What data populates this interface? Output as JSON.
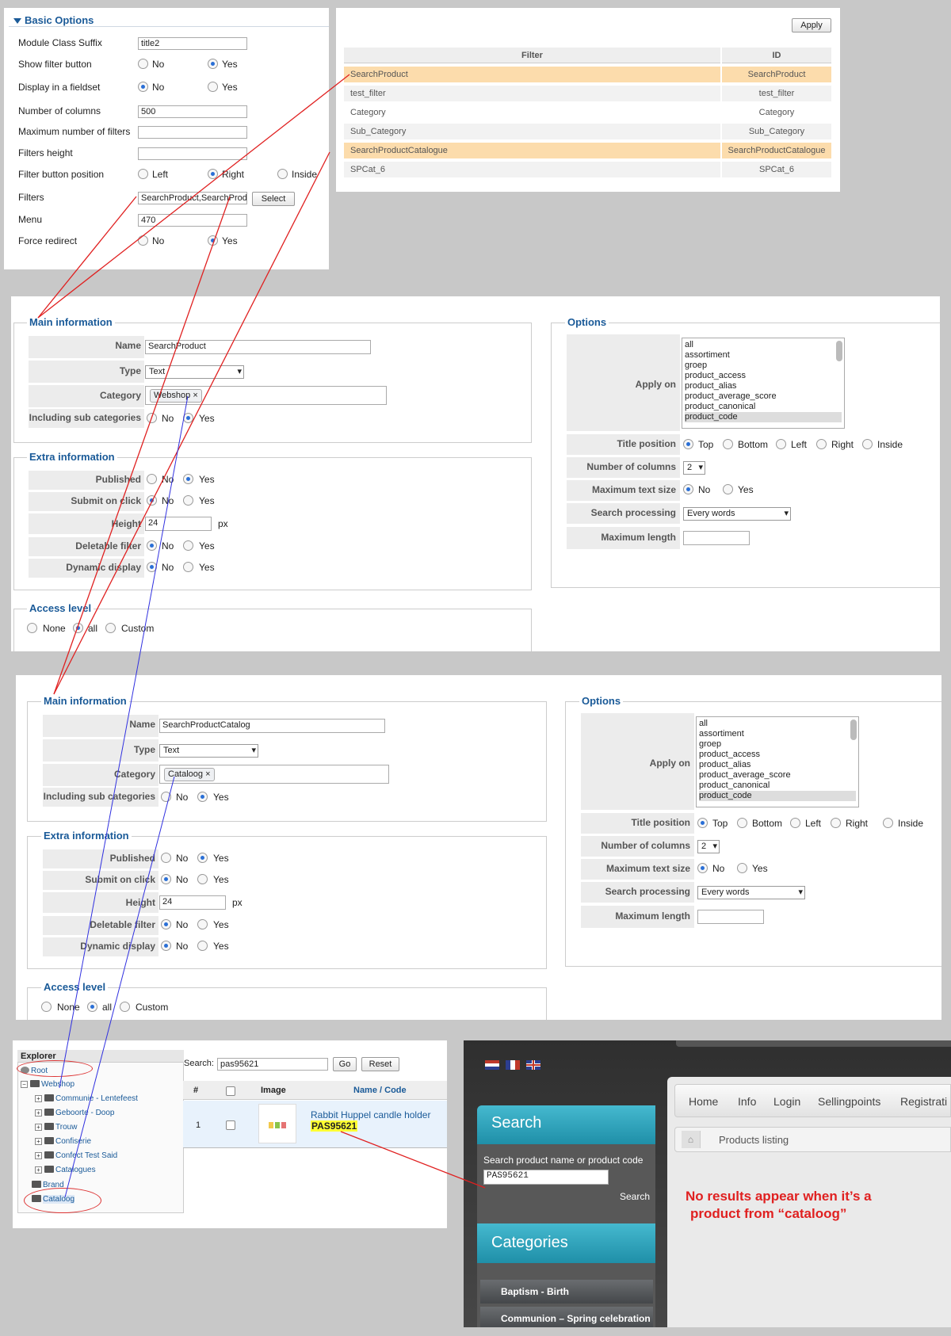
{
  "basic_options": {
    "title": "Basic Options",
    "module_class_suffix_label": "Module Class Suffix",
    "module_class_suffix_value": "title2",
    "show_filter_button_label": "Show filter button",
    "display_fieldset_label": "Display in a fieldset",
    "num_columns_label": "Number of columns",
    "num_columns_value": "500",
    "max_filters_label": "Maximum number of filters",
    "filters_height_label": "Filters height",
    "filter_button_position_label": "Filter button position",
    "filters_label": "Filters",
    "filters_value": "SearchProduct,SearchProduct",
    "select_button": "Select",
    "menu_label": "Menu",
    "menu_value": "470",
    "force_redirect_label": "Force redirect",
    "no": "No",
    "yes": "Yes",
    "left": "Left",
    "right": "Right",
    "inside": "Inside"
  },
  "filter_table": {
    "apply_button": "Apply",
    "col_filter": "Filter",
    "col_id": "ID",
    "rows": [
      {
        "filter": "SearchProduct",
        "id": "SearchProduct"
      },
      {
        "filter": "test_filter",
        "id": "test_filter"
      },
      {
        "filter": "Category",
        "id": "Category"
      },
      {
        "filter": "Sub_Category",
        "id": "Sub_Category"
      },
      {
        "filter": "SearchProductCatalogue",
        "id": "SearchProductCatalogue"
      },
      {
        "filter": "SPCat_6",
        "id": "SPCat_6"
      }
    ]
  },
  "form_labels": {
    "main_information": "Main information",
    "extra_information": "Extra information",
    "access_level": "Access level",
    "options": "Options",
    "name": "Name",
    "type": "Type",
    "category": "Category",
    "including_sub": "Including sub categories",
    "published": "Published",
    "submit_on_click": "Submit on click",
    "height": "Height",
    "deletable_filter": "Deletable filter",
    "dynamic_display": "Dynamic display",
    "none": "None",
    "all": "all",
    "custom": "Custom",
    "apply_on": "Apply on",
    "title_position": "Title position",
    "number_of_columns": "Number of columns",
    "maximum_text_size": "Maximum text size",
    "search_processing": "Search processing",
    "maximum_length": "Maximum length",
    "top": "Top",
    "bottom": "Bottom",
    "left": "Left",
    "right": "Right",
    "inside": "Inside",
    "no": "No",
    "yes": "Yes",
    "px": "px",
    "type_value": "Text",
    "height_value": "24",
    "columns_value": "2",
    "search_processing_value": "Every words",
    "apply_on_options": [
      "all",
      "assortiment",
      "groep",
      "product_access",
      "product_alias",
      "product_average_score",
      "product_canonical",
      "product_code"
    ]
  },
  "form1": {
    "name_value": "SearchProduct",
    "category_chip": "Webshop"
  },
  "form2": {
    "name_value": "SearchProductCatalog",
    "category_chip": "Cataloog"
  },
  "explorer": {
    "title": "Explorer",
    "root": "Root",
    "webshop": "Webshop",
    "children": [
      "Communie - Lentefeest",
      "Geboorte - Doop",
      "Trouw",
      "Confiserie",
      "Confect Test Said",
      "Catalogues"
    ],
    "brand": "Brand",
    "cataloog": "Cataloog",
    "search_label": "Search:",
    "search_value": "pas95621",
    "go_button": "Go",
    "reset_button": "Reset",
    "col_num": "#",
    "col_image": "Image",
    "col_name": "Name / Code",
    "row_num": "1",
    "product_name": "Rabbit Huppel candle holder",
    "product_code": "PAS95621"
  },
  "storefront": {
    "nav": [
      "Home",
      "Info",
      "Login",
      "Sellingpoints",
      "Registrati"
    ],
    "breadcrumb": "Products listing",
    "search_title": "Search",
    "search_label": "Search product name or product code",
    "search_value": "PAS95621",
    "search_button": "Search",
    "categories_title": "Categories",
    "categories": [
      "Baptism - Birth",
      "Communion – Spring celebration"
    ],
    "note_line1": "No results appear when it’s a",
    "note_line2": "product from “cataloog”"
  }
}
